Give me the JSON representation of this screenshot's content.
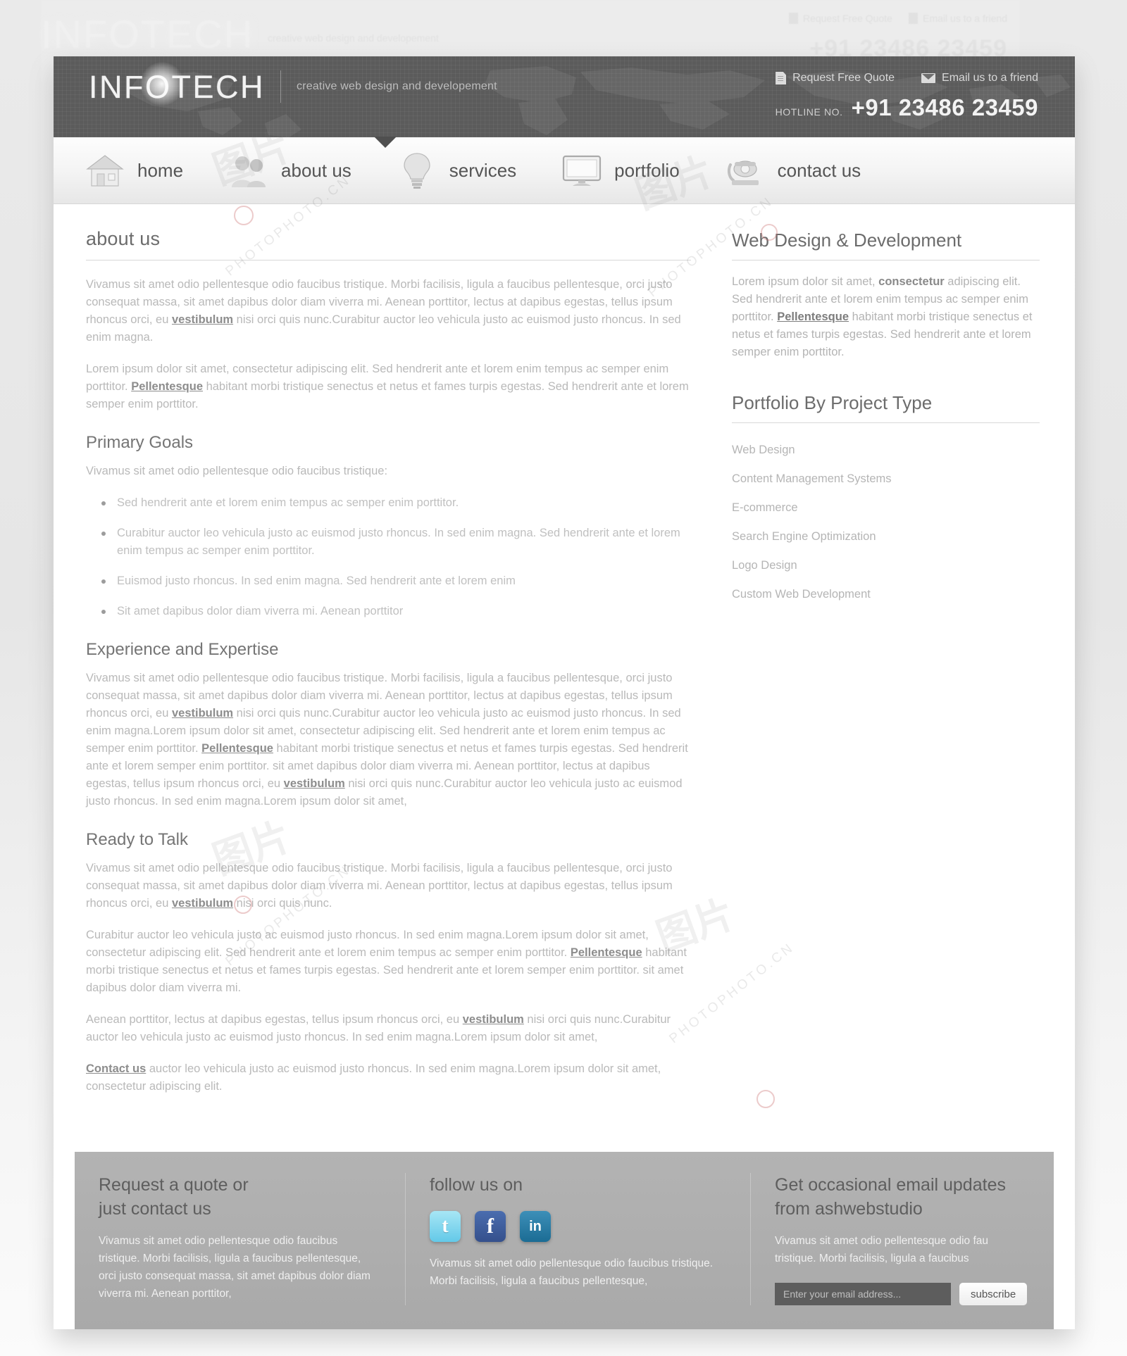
{
  "header": {
    "logo": "INFOTECH",
    "tagline": "creative web design and developement",
    "links": [
      {
        "icon": "document-icon",
        "label": "Request Free Quote"
      },
      {
        "icon": "mail-icon",
        "label": "Email us to a friend"
      }
    ],
    "hotline_label": "HOTLINE NO.",
    "hotline_number": "+91 23486 23459"
  },
  "nav": {
    "items": [
      {
        "label": "home",
        "icon": "house-icon"
      },
      {
        "label": "about us",
        "icon": "people-icon"
      },
      {
        "label": "services",
        "icon": "lightbulb-icon"
      },
      {
        "label": "portfolio",
        "icon": "monitor-icon"
      },
      {
        "label": "contact us",
        "icon": "telephone-icon"
      }
    ]
  },
  "content": {
    "title": "about us",
    "p1_a": "Vivamus sit amet odio pellentesque odio faucibus tristique. Morbi facilisis, ligula a faucibus pellentesque, orci justo consequat massa, sit amet dapibus dolor diam viverra mi. Aenean porttitor, lectus at dapibus egestas, tellus ipsum rhoncus orci, eu ",
    "p1_link": "vestibulum",
    "p1_b": " nisi orci quis nunc.Curabitur auctor leo vehicula justo ac euismod justo rhoncus. In sed enim magna.",
    "p2_a": "Lorem ipsum dolor sit amet, consectetur adipiscing elit. Sed hendrerit ante et lorem enim tempus ac semper enim porttitor. ",
    "p2_link": "Pellentesque",
    "p2_b": " habitant morbi tristique senectus et netus et fames turpis egestas. Sed hendrerit ante et lorem semper enim porttitor.",
    "goals_heading": "Primary Goals",
    "goals_intro": "Vivamus sit amet odio pellentesque odio faucibus tristique:",
    "goals": [
      "Sed hendrerit ante et lorem enim tempus ac semper enim porttitor.",
      "Curabitur auctor leo vehicula justo ac euismod justo rhoncus. In sed enim magna. Sed hendrerit ante et lorem enim tempus ac semper enim porttitor.",
      "Euismod justo rhoncus. In sed enim magna. Sed hendrerit ante et lorem enim",
      "Sit amet dapibus dolor diam viverra mi. Aenean porttitor"
    ],
    "exp_heading": "Experience and Expertise",
    "exp_a": "Vivamus sit amet odio pellentesque odio faucibus tristique. Morbi facilisis, ligula a faucibus pellentesque, orci justo consequat massa, sit amet dapibus dolor diam viverra mi. Aenean porttitor, lectus at dapibus egestas, tellus ipsum rhoncus orci, eu ",
    "exp_link1": "vestibulum",
    "exp_b": " nisi orci quis nunc.Curabitur auctor leo vehicula justo ac euismod justo rhoncus. In sed enim magna.Lorem ipsum dolor sit amet, consectetur adipiscing elit. Sed hendrerit ante et lorem enim tempus ac semper enim porttitor. ",
    "exp_link2": "Pellentesque",
    "exp_c": " habitant morbi tristique senectus et netus et fames turpis egestas. Sed hendrerit ante et lorem semper enim porttitor. sit amet dapibus dolor diam viverra mi. Aenean porttitor, lectus at dapibus egestas, tellus ipsum rhoncus orci, eu ",
    "exp_link3": "vestibulum",
    "exp_d": " nisi orci quis nunc.Curabitur auctor leo vehicula justo ac euismod justo rhoncus. In sed enim magna.Lorem ipsum dolor sit amet,",
    "talk_heading": "Ready to Talk",
    "talk1_a": "Vivamus sit amet odio pellentesque odio faucibus tristique. Morbi facilisis, ligula a faucibus pellentesque, orci justo consequat massa, sit amet dapibus dolor diam viverra mi. Aenean porttitor, lectus at dapibus egestas, tellus ipsum rhoncus orci, eu ",
    "talk1_link": "vestibulum",
    "talk1_b": " nisi orci quis nunc.",
    "talk2_a": "Curabitur auctor leo vehicula justo ac euismod justo rhoncus. In sed enim magna.Lorem ipsum dolor sit amet, consectetur adipiscing elit. Sed hendrerit ante et lorem enim tempus ac semper enim porttitor. ",
    "talk2_link": "Pellentesque",
    "talk2_b": " habitant morbi tristique senectus et netus et fames turpis egestas. Sed hendrerit ante et lorem semper enim porttitor. sit amet dapibus dolor diam viverra mi.",
    "talk3_a": "Aenean porttitor, lectus at dapibus egestas, tellus ipsum rhoncus orci, eu ",
    "talk3_link": "vestibulum",
    "talk3_b": " nisi orci quis nunc.Curabitur auctor leo vehicula justo ac euismod justo rhoncus. In sed enim magna.Lorem ipsum dolor sit amet,",
    "talk4_link": "Contact us",
    "talk4_b": " auctor leo vehicula justo ac euismod justo rhoncus. In sed enim magna.Lorem ipsum dolor sit amet, consectetur adipiscing elit."
  },
  "aside": {
    "wd_title": "Web Design & Development",
    "wd_a": "Lorem ipsum dolor sit amet, ",
    "wd_bold": "consectetur",
    "wd_b": " adipiscing elit. Sed hendrerit ante et lorem enim tempus ac semper enim porttitor. ",
    "wd_link": "Pellentesque",
    "wd_c": " habitant morbi tristique senectus et netus et fames turpis egestas. Sed hendrerit ante et lorem semper enim porttitor.",
    "pf_title": "Portfolio By Project Type",
    "pf_items": [
      "Web Design",
      "Content Management Systems",
      "E-commerce",
      "Search Engine Optimization",
      "Logo Design",
      "Custom Web Development"
    ]
  },
  "footer": {
    "quote_title_line1": "Request a quote or",
    "quote_title_line2": "just contact us",
    "quote_text": "Vivamus sit amet odio pellentesque odio faucibus tristique. Morbi facilisis, ligula a faucibus pellentesque, orci justo consequat massa, sit amet dapibus dolor diam viverra mi. Aenean porttitor,",
    "follow_title": "follow us on",
    "socials": [
      {
        "name": "twitter-icon",
        "glyph": "t",
        "color": "#63c9e8"
      },
      {
        "name": "facebook-icon",
        "glyph": "f",
        "color": "#35508c"
      },
      {
        "name": "linkedin-icon",
        "glyph": "in",
        "color": "#1b6c94"
      }
    ],
    "follow_text": "Vivamus sit amet odio pellentesque odio faucibus tristique. Morbi facilisis, ligula a faucibus pellentesque,",
    "news_title_line1": "Get occasional email updates",
    "news_title_line2": "from ashwebstudio",
    "news_text": "Vivamus sit amet odio pellentesque odio fau tristique. Morbi facilisis, ligula a faucibus",
    "email_placeholder": "Enter your email address...",
    "subscribe_label": "subscribe"
  },
  "ghost": {
    "logo": "INFOTECH",
    "tagline": "creative web design and developement",
    "link1": "Request Free Quote",
    "link2": "Email us to a friend",
    "hotline": "+91 23486 23459"
  },
  "watermarks": {
    "photo": "PHOTOPHOTO.CN",
    "cn": "图片"
  },
  "colors": {
    "header_bg": "#5b5b5b",
    "footer_bg": "#aeaeae",
    "text_muted": "#b9b9b9",
    "heading": "#6c6c6c",
    "twitter": "#63c9e8",
    "facebook": "#35508c",
    "linkedin": "#1b6c94"
  }
}
